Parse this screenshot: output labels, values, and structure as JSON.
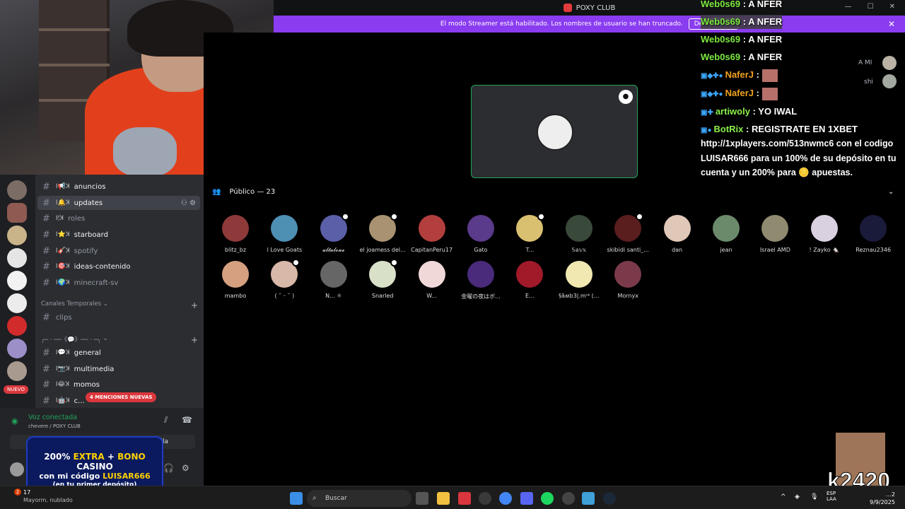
{
  "titlebar": {
    "title": "POXY CLUB"
  },
  "streamer_banner": {
    "text": "El modo Streamer está habilitado. Los nombres de usuario se han truncado.",
    "button": "Deshabilitar",
    "close": "✕"
  },
  "channels": [
    {
      "name": "anuncios",
      "prefix": "ꓲ📢ꓘ"
    },
    {
      "name": "updates",
      "prefix": "ꓲ🔔ꓘ"
    },
    {
      "name": "roles",
      "prefix": "ꓲ🕯ꓘ"
    },
    {
      "name": "starboard",
      "prefix": "ꓲ⭐ꓘ"
    },
    {
      "name": "spotify",
      "prefix": "ꓲ🎸ꓘ"
    },
    {
      "name": "ideas-contenido",
      "prefix": "ꓲ🎯ꓘ"
    },
    {
      "name": "minecraft-sv",
      "prefix": "ꓲ🌍ꓘ"
    }
  ],
  "category_temp": "Canales Temporales",
  "clips_channel": "clips",
  "category_2": "╭─ · ──《💬》── · ─╮",
  "channels_2": [
    {
      "name": "general",
      "prefix": "ꓲ💬ꓘ"
    },
    {
      "name": "multimedia",
      "prefix": "ꓲ📷ꓘ"
    },
    {
      "name": "momos",
      "prefix": "ꓲ😂ꓘ"
    },
    {
      "name": "c...",
      "prefix": "ꓲ🤖ꓘ"
    }
  ],
  "mentions_pill": "4 MENCIONES NUEVAS",
  "nuevo_badge": "NUEVO",
  "voice": {
    "status": "Voz conectada",
    "location": "chevere / POXY CLUB",
    "button_partial": "lla"
  },
  "ad": {
    "line1_pre": "200%",
    "line1_hl": "EXTRA",
    "line1_mid": " + ",
    "line1_hl2": "BONO",
    "line1_post": " CASINO",
    "line2_pre": "con mi código ",
    "line2_hl": "LUISAR666",
    "line3": "(en tu primer depósito)"
  },
  "audience": {
    "heading": "Público — 23"
  },
  "members": [
    "blitz_bz",
    "l Love Goats",
    "𝓪𝓵𝓽𝓪𝓵𝓸𝓷𝓮",
    "el joamess del...",
    "CapitanPeru17",
    "Gato",
    "T...",
    "𝕊𝕒𝕧𝕩",
    "skibidi santi_...",
    "dan",
    "jean",
    "Israel AMD",
    "! Zayko 🐁",
    "Reznau2346",
    "mambo",
    "( ˘ ᵕ ˘ )",
    "N... ⚛",
    "Snarled",
    "W...",
    "金曜の夜はボ...",
    "E...",
    "§ãʍb3|.mᶦ⁴ (...",
    "Mornyx"
  ],
  "chat": [
    {
      "user": "Web0s69",
      "text": "A NFER"
    },
    {
      "user": "Web0s69",
      "text": "A NFER"
    },
    {
      "user": "Web0s69",
      "text": "A NFER"
    },
    {
      "user": "Web0s69",
      "text": "A NFER"
    },
    {
      "user": "NaferJ",
      "text": ""
    },
    {
      "user": "NaferJ",
      "text": ""
    },
    {
      "user": "artiwoly",
      "text": "YO IWAL"
    },
    {
      "user": "BotRix",
      "text": "REGISTRATE EN 1XBET"
    }
  ],
  "chat_cont": [
    "http://1xplayers.com/513nwmc6 con el codigo",
    "LUISAR666 para un 100% de su depósito en tu",
    "cuenta y un 200% para  🪙  apuestas."
  ],
  "side_notes": [
    "A MI",
    "shi"
  ],
  "kick_text": "k2420",
  "taskbar": {
    "weather_temp": "17",
    "weather_desc": "Mayorm. nublado",
    "weather_badge": "2",
    "search_placeholder": "Buscar",
    "lang": "ESP LAA",
    "time": "…2",
    "date": "9/9/2025"
  }
}
